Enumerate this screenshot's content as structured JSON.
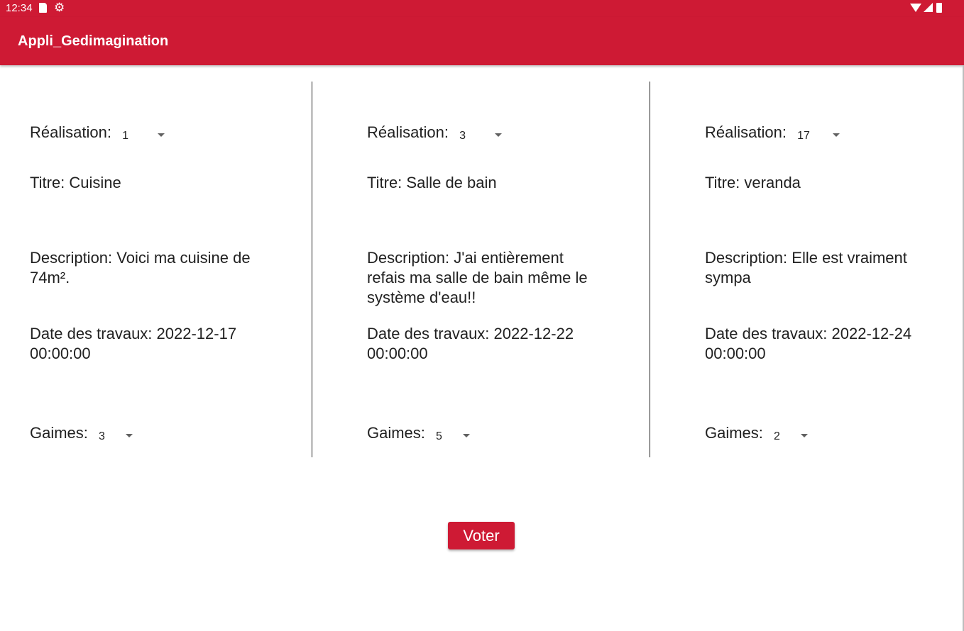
{
  "status_bar": {
    "time": "12:34"
  },
  "app_bar": {
    "title": "Appli_Gedimagination"
  },
  "realisations": [
    {
      "realisation_label": "Réalisation:",
      "realisation_value": "1",
      "titre": "Titre: Cuisine",
      "description": "Description: Voici ma cuisine de 74m².",
      "date": "Date des travaux: 2022-12-17 00:00:00",
      "gaimes_label": "Gaimes:",
      "gaimes_value": "3"
    },
    {
      "realisation_label": "Réalisation:",
      "realisation_value": "3",
      "titre": "Titre: Salle de bain",
      "description": "Description: J'ai entièrement refais ma salle de bain même le système d'eau!!",
      "date": "Date des travaux: 2022-12-22 00:00:00",
      "gaimes_label": "Gaimes:",
      "gaimes_value": "5"
    },
    {
      "realisation_label": "Réalisation:",
      "realisation_value": "17",
      "titre": "Titre: veranda",
      "description": "Description: Elle est vraiment sympa",
      "date": "Date des travaux: 2022-12-24 00:00:00",
      "gaimes_label": "Gaimes:",
      "gaimes_value": "2"
    }
  ],
  "vote_button": {
    "label": "Voter"
  },
  "colors": {
    "primary": "#ce1a34",
    "text": "#212121"
  }
}
